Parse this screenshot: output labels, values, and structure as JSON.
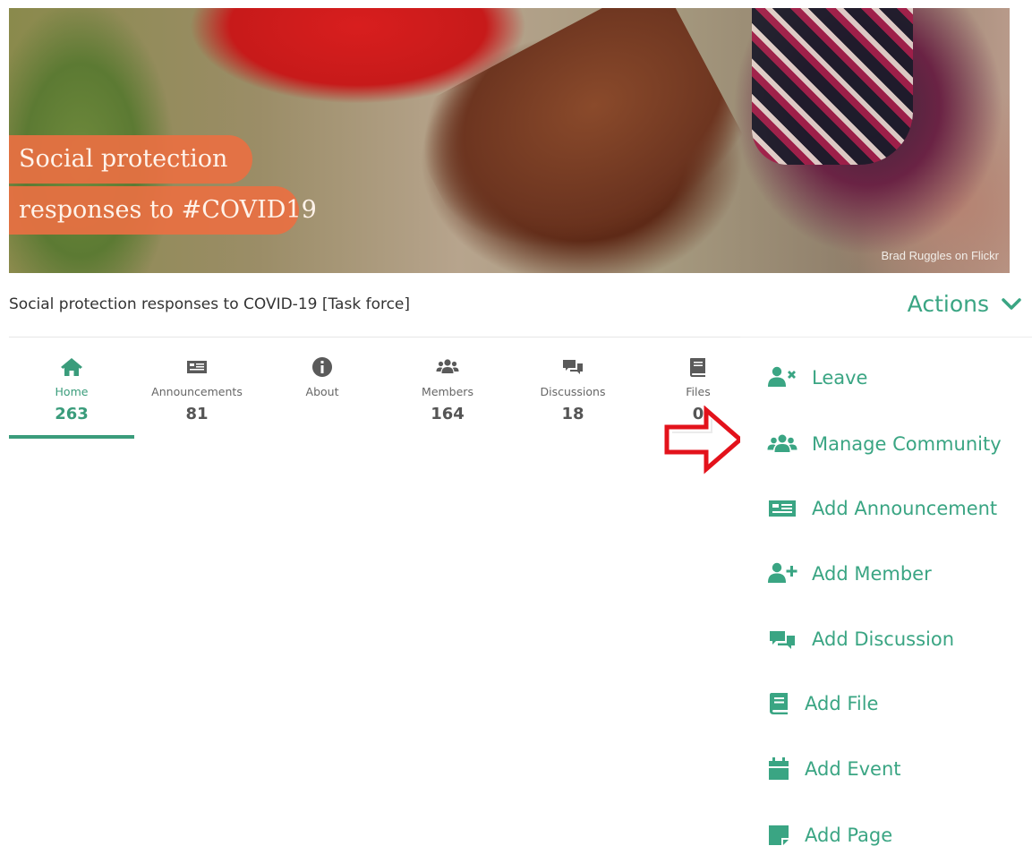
{
  "banner": {
    "tag_line_1": "Social protection",
    "tag_line_2": "responses to #COVID19",
    "photo_credit": "Brad Ruggles on Flickr"
  },
  "community": {
    "title": "Social protection responses to COVID-19 [Task force]"
  },
  "actions": {
    "label": "Actions",
    "toggle_icon": "chevron-down-icon",
    "items": [
      {
        "label": "Leave",
        "icon": "user-remove-icon"
      },
      {
        "label": "Manage Community",
        "icon": "users-icon"
      },
      {
        "label": "Add Announcement",
        "icon": "newspaper-icon"
      },
      {
        "label": "Add Member",
        "icon": "user-plus-icon"
      },
      {
        "label": "Add Discussion",
        "icon": "comments-icon"
      },
      {
        "label": "Add File",
        "icon": "book-icon"
      },
      {
        "label": "Add Event",
        "icon": "calendar-icon"
      },
      {
        "label": "Add Page",
        "icon": "sticky-note-icon"
      }
    ]
  },
  "tabs": [
    {
      "label": "Home",
      "count": "263",
      "icon": "home-icon",
      "active": true
    },
    {
      "label": "Announcements",
      "count": "81",
      "icon": "newspaper-icon",
      "active": false
    },
    {
      "label": "About",
      "count": "",
      "icon": "info-circle-icon",
      "active": false
    },
    {
      "label": "Members",
      "count": "164",
      "icon": "users-icon",
      "active": false
    },
    {
      "label": "Discussions",
      "count": "18",
      "icon": "comments-icon",
      "active": false
    },
    {
      "label": "Files",
      "count": "0",
      "icon": "book-icon",
      "active": false
    }
  ],
  "colors": {
    "accent": "#3aa583",
    "tab_active": "#3a9c7b",
    "tag_background": "#e97042",
    "callout_arrow": "#e3121b"
  }
}
